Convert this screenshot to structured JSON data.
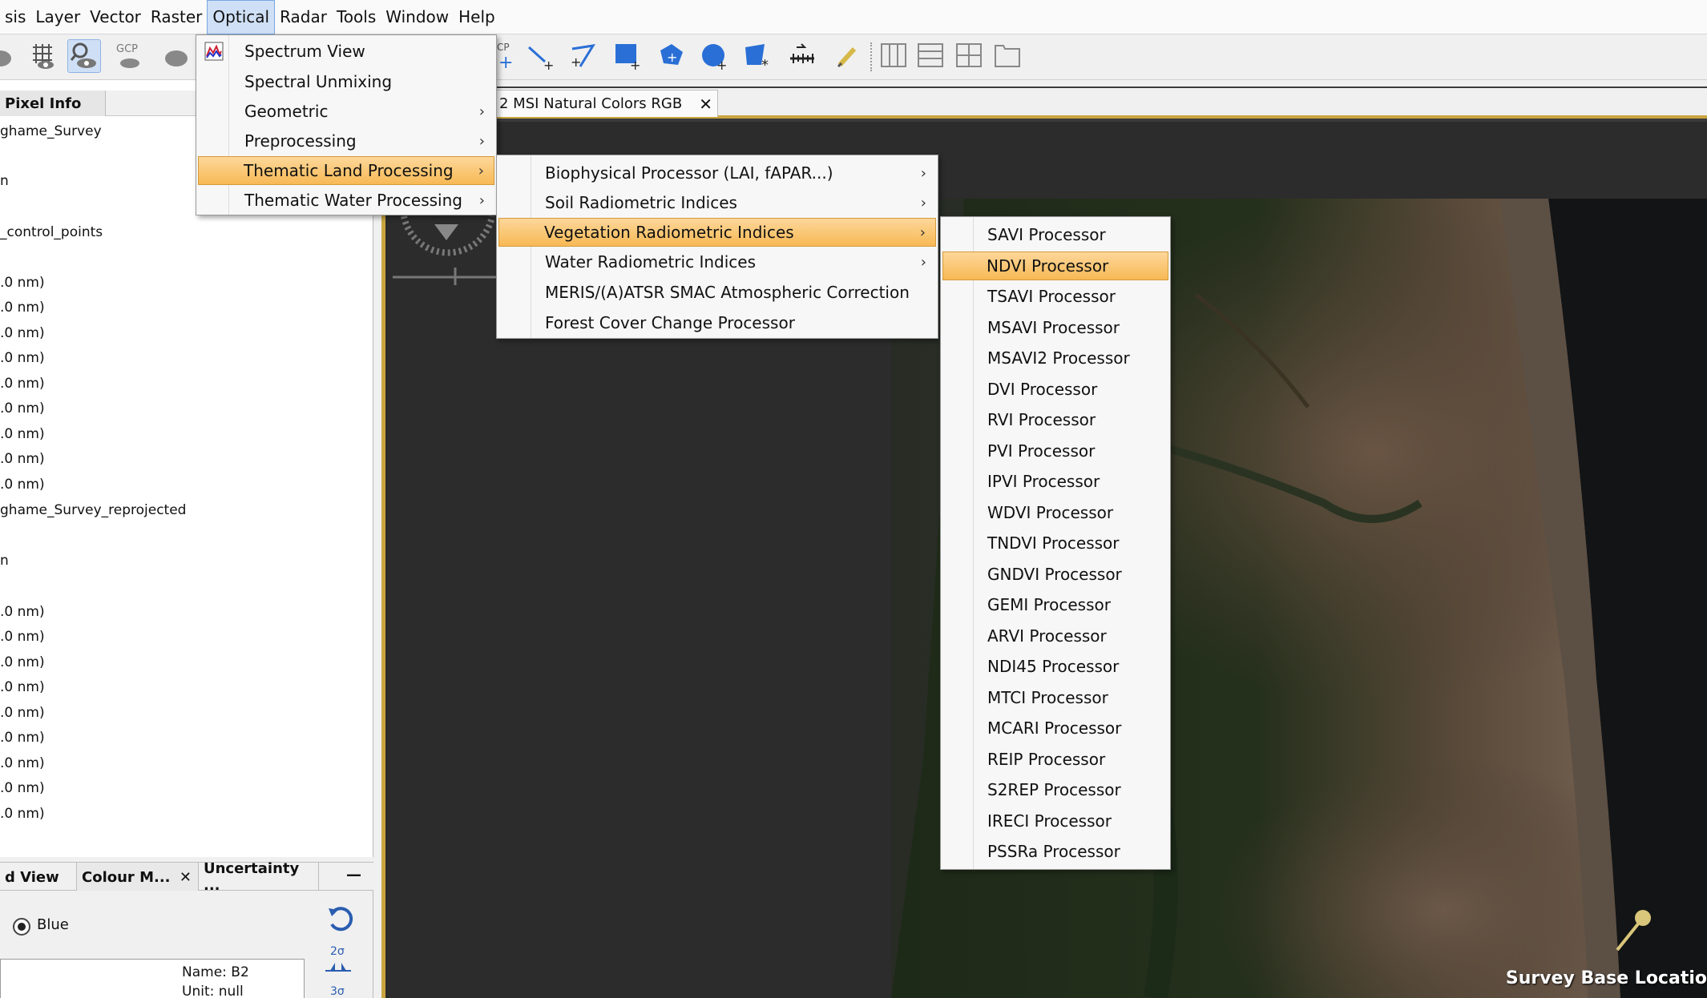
{
  "menubar": {
    "items": [
      "sis",
      "Layer",
      "Vector",
      "Raster",
      "Optical",
      "Radar",
      "Tools",
      "Window",
      "Help"
    ],
    "active_index": 4
  },
  "toolbar": {
    "gcp_label": "GCP",
    "gcp_label_2": "CP",
    "icons": [
      "layer-icon",
      "graticule-icon",
      "pixel-info-icon",
      "gcp-icon",
      "pin-icon",
      "line-draw-icon",
      "polyline-draw-icon",
      "rectangle-draw-icon",
      "polygon-draw-icon",
      "ellipse-draw-icon",
      "magic-wand-icon",
      "range-finder-icon",
      "pencil-icon",
      "tile-evenly-icon",
      "tile-horizontal-icon",
      "tile-vertical-icon",
      "single-window-icon"
    ]
  },
  "left_panel": {
    "tab_label": "Pixel Info",
    "tree_lines": [
      "ghame_Survey",
      "n",
      "_control_points",
      ".0 nm)",
      ".0 nm)",
      ".0 nm)",
      ".0 nm)",
      ".0 nm)",
      ".0 nm)",
      ".0 nm)",
      ".0 nm)",
      ".0 nm)",
      "ghame_Survey_reprojected",
      "n",
      ".0 nm)",
      ".0 nm)",
      ".0 nm)",
      ".0 nm)",
      ".0 nm)",
      ".0 nm)",
      ".0 nm)",
      ".0 nm)",
      ".0 nm)"
    ]
  },
  "bottom_left": {
    "tabs": [
      "d View",
      "Colour M...",
      "Uncertainty ..."
    ],
    "close_glyph": "✕",
    "minimize_glyph": "—",
    "radio_label": "Blue",
    "name_line": "Name: B2",
    "unit_line": "Unit: null",
    "sigma_2": "2σ",
    "sigma_3": "3σ"
  },
  "view": {
    "tab_label": "2 MSI Natural Colors RGB",
    "tab_close": "✕",
    "overlay_label": "Survey Base Locatio"
  },
  "menus": {
    "optical": {
      "items": [
        {
          "label": "Spectrum View",
          "submenu": false
        },
        {
          "label": "Spectral Unmixing",
          "submenu": false
        },
        {
          "label": "Geometric",
          "submenu": true
        },
        {
          "label": "Preprocessing",
          "submenu": true
        },
        {
          "label": "Thematic Land Processing",
          "submenu": true
        },
        {
          "label": "Thematic Water Processing",
          "submenu": true
        }
      ],
      "highlight_index": 4
    },
    "thematic_land": {
      "items": [
        {
          "label": "Biophysical Processor (LAI, fAPAR...)",
          "submenu": true
        },
        {
          "label": "Soil Radiometric Indices",
          "submenu": true
        },
        {
          "label": "Vegetation Radiometric Indices",
          "submenu": true
        },
        {
          "label": "Water Radiometric Indices",
          "submenu": true
        },
        {
          "label": "MERIS/(A)ATSR SMAC Atmospheric Correction",
          "submenu": false
        },
        {
          "label": "Forest Cover Change Processor",
          "submenu": false
        }
      ],
      "highlight_index": 2
    },
    "vegetation": {
      "items": [
        "SAVI Processor",
        "NDVI Processor",
        "TSAVI Processor",
        "MSAVI Processor",
        "MSAVI2 Processor",
        "DVI Processor",
        "RVI Processor",
        "PVI Processor",
        "IPVI Processor",
        "WDVI Processor",
        "TNDVI Processor",
        "GNDVI Processor",
        "GEMI Processor",
        "ARVI Processor",
        "NDI45 Processor",
        "MTCI Processor",
        "MCARI Processor",
        "REIP Processor",
        "S2REP Processor",
        "IRECI Processor",
        "PSSRa Processor"
      ],
      "highlight_index": 1
    },
    "arrow_glyph": "›"
  },
  "colors": {
    "menu_highlight": "#f7b955",
    "accent_gold": "#c9a440",
    "menubar_active": "#cfe0f6"
  }
}
